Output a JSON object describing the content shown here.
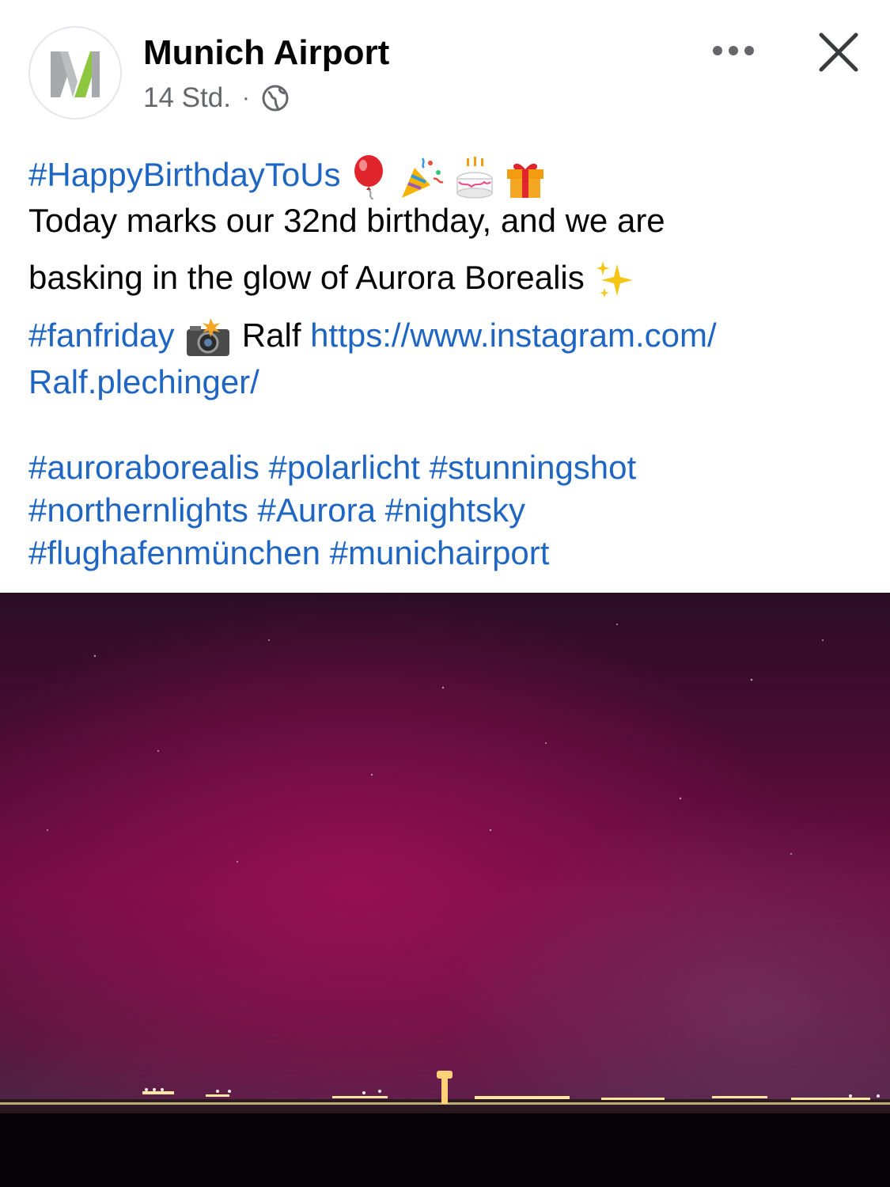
{
  "post": {
    "page_name": "Munich Airport",
    "time": "14 Std.",
    "separator": "·",
    "hashtag_birthday": "#HappyBirthdayToUs",
    "text_line1": "Today marks our 32nd birthday, and we are",
    "text_line2": "basking in the glow of Aurora Borealis",
    "hashtag_fanfriday": "#fanfriday",
    "credit_name": "Ralf",
    "url_part1": "https://www.instagram.com/",
    "url_part2": "Ralf.plechinger/",
    "hashtags": [
      "#aurorаborealis",
      "#polarlicht",
      "#stunningshot",
      "#northernlights",
      "#Aurora",
      "#nightsky",
      "#flughafenmünchen",
      "#munichairport"
    ]
  },
  "icons": {
    "balloon": "balloon-icon",
    "party_popper": "party-popper-icon",
    "cake": "birthday-cake-icon",
    "gift": "gift-icon",
    "sparkles": "sparkles-icon",
    "camera_flash": "camera-flash-icon",
    "globe": "globe-icon",
    "more": "more-options-icon",
    "close": "close-icon"
  },
  "colors": {
    "link": "#1f66c2",
    "secondary_text": "#65676b",
    "logo_green": "#8dc63f",
    "logo_gray": "#9e9e9e",
    "aurora_magenta": "#8e0a4e",
    "sky_dark": "#2a0d24"
  }
}
